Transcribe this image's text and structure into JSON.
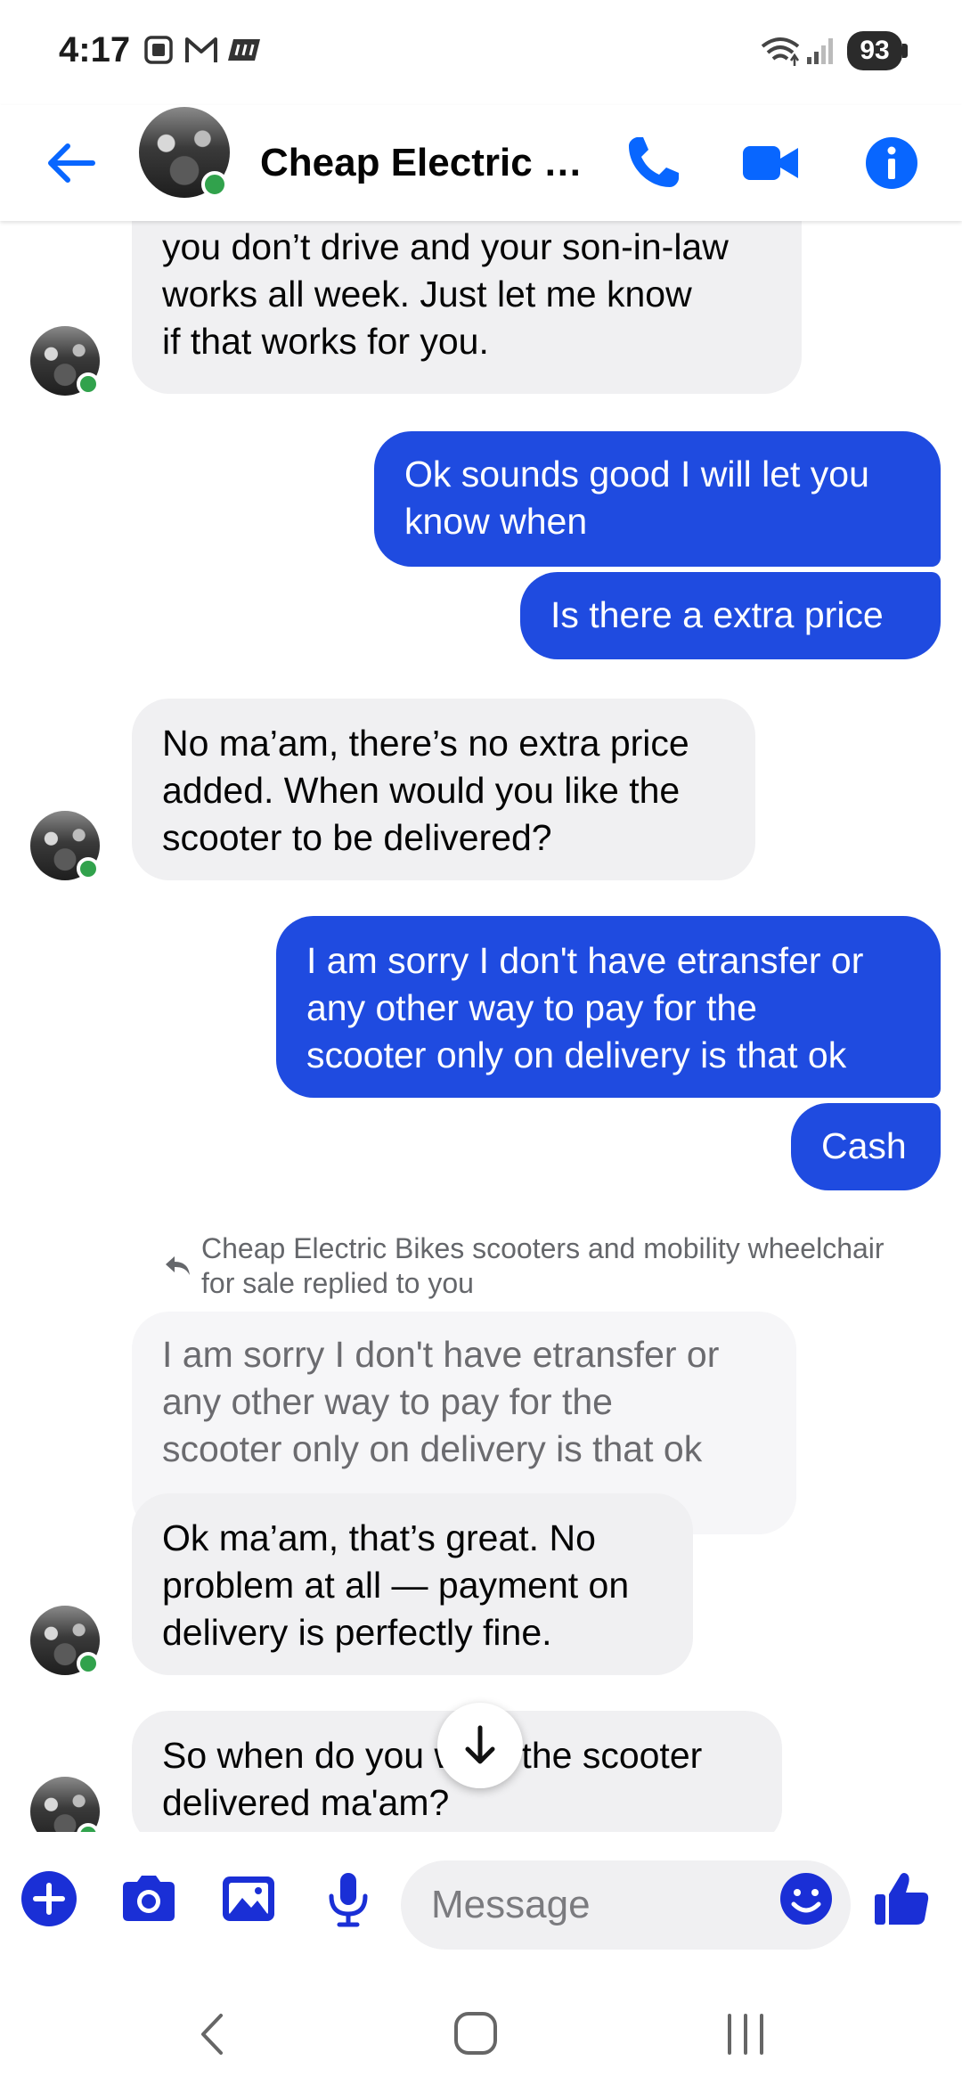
{
  "status_bar": {
    "time": "4:17",
    "battery": "93"
  },
  "header": {
    "contact_name": "Cheap Electric Bi..."
  },
  "messages": {
    "m1": "scooter to you since I understand\nyou don’t drive and your son-in-law\nworks all week. Just let me know\nif that works for you.",
    "m2": "Ok sounds good I will let you\nknow when",
    "m3": "Is there a extra price",
    "m4": "No ma’am, there’s no extra price\nadded. When would you like the\nscooter to be delivered?",
    "m5": "I am sorry I don't have etransfer or\nany other way to pay for the\nscooter only on delivery  is that ok",
    "m6": "Cash",
    "reply_label": "Cheap Electric Bikes scooters and mobility wheelchair\nfor sale replied to you",
    "reply_quote": "I am sorry I don't have etransfer or\nany other way to pay for the\nscooter only on delivery  is that ok",
    "m7": "Ok ma’am, that’s great. No\nproblem at all — payment on\ndelivery is perfectly fine.",
    "m8": "So when do you want the scooter\ndelivered ma'am?"
  },
  "composer": {
    "placeholder": "Message"
  },
  "colors": {
    "accent": "#0866ff",
    "outgoing_bubble": "#1f4be0",
    "incoming_bubble": "#f0f0f2",
    "online": "#31a24c"
  },
  "icons": {
    "header": [
      "back-arrow-icon",
      "phone-icon",
      "video-camera-icon",
      "info-icon"
    ],
    "composer": [
      "plus-icon",
      "camera-icon",
      "gallery-icon",
      "microphone-icon",
      "emoji-icon",
      "thumbs-up-icon"
    ],
    "navigation": [
      "nav-back-icon",
      "nav-home-icon",
      "nav-recents-icon"
    ]
  }
}
